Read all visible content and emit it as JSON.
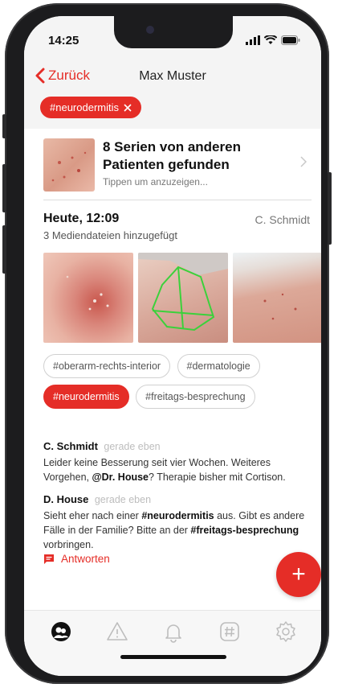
{
  "status": {
    "time": "14:25"
  },
  "nav": {
    "back_label": "Zurück",
    "title": "Max Muster"
  },
  "filter": {
    "chip_label": "#neurodermitis"
  },
  "series": {
    "title": "8 Serien von anderen Patienten gefunden",
    "subtitle": "Tippen um anzuzeigen..."
  },
  "entry": {
    "date": "Heute, 12:09",
    "user": "C. Schmidt",
    "media_summary": "3 Mediendateien hinzugefügt",
    "tags": [
      {
        "label": "#oberarm-rechts-interior",
        "active": false
      },
      {
        "label": "#dermatologie",
        "active": false
      },
      {
        "label": "#neurodermitis",
        "active": true
      },
      {
        "label": "#freitags-besprechung",
        "active": false
      }
    ]
  },
  "comments": [
    {
      "author": "C. Schmidt",
      "time": "gerade eben",
      "text_a": "Leider keine Besserung seit vier Wochen. Weiteres Vorgehen, ",
      "mention": "@Dr. House",
      "text_b": "? Therapie bisher mit Cortison."
    },
    {
      "author": "D. House",
      "time": "gerade eben",
      "text_a": "Sieht eher nach einer ",
      "tag1": "#neurodermitis",
      "text_b": " aus. Gibt es andere Fälle in der Familie? Bitte an der ",
      "tag2": "#freitags-besprechung",
      "text_c": " vorbringen."
    }
  ],
  "reply": {
    "label": "Antworten"
  },
  "fab": {
    "label": "+"
  },
  "colors": {
    "accent": "#e52d27"
  },
  "tabs": [
    "patients-icon",
    "warning-icon",
    "bell-icon",
    "hashtag-icon",
    "settings-icon"
  ]
}
